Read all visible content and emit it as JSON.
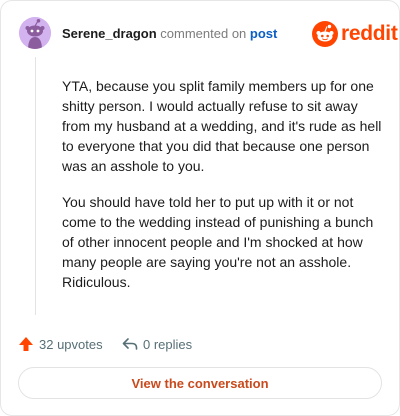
{
  "header": {
    "username": "Serene_dragon",
    "action_text": "commented on",
    "post_link": "post",
    "brand": "reddit"
  },
  "comment": {
    "paragraphs": [
      "YTA, because you split family members up for one shitty person. I would actually refuse to sit away from my husband at a wedding, and it's rude as hell to everyone that you did that because one person was an asshole to you.",
      "You should have told her to put up with it or not come to the wedding instead of punishing a bunch of other innocent people and I'm shocked at how many people are saying you're not an asshole. Ridiculous."
    ]
  },
  "footer": {
    "upvotes_label": "32 upvotes",
    "replies_label": "0 replies",
    "view_button": "View the conversation"
  },
  "icons": {
    "upvote": "arrow-up-icon",
    "reply": "reply-arrow-icon",
    "avatar": "snoo-avatar-icon",
    "logo": "reddit-snoo-logo"
  },
  "colors": {
    "brand": "#ff4500",
    "link": "#0a5ec4",
    "button_text": "#c84a1d",
    "avatar_bg": "#d3b2f0"
  }
}
